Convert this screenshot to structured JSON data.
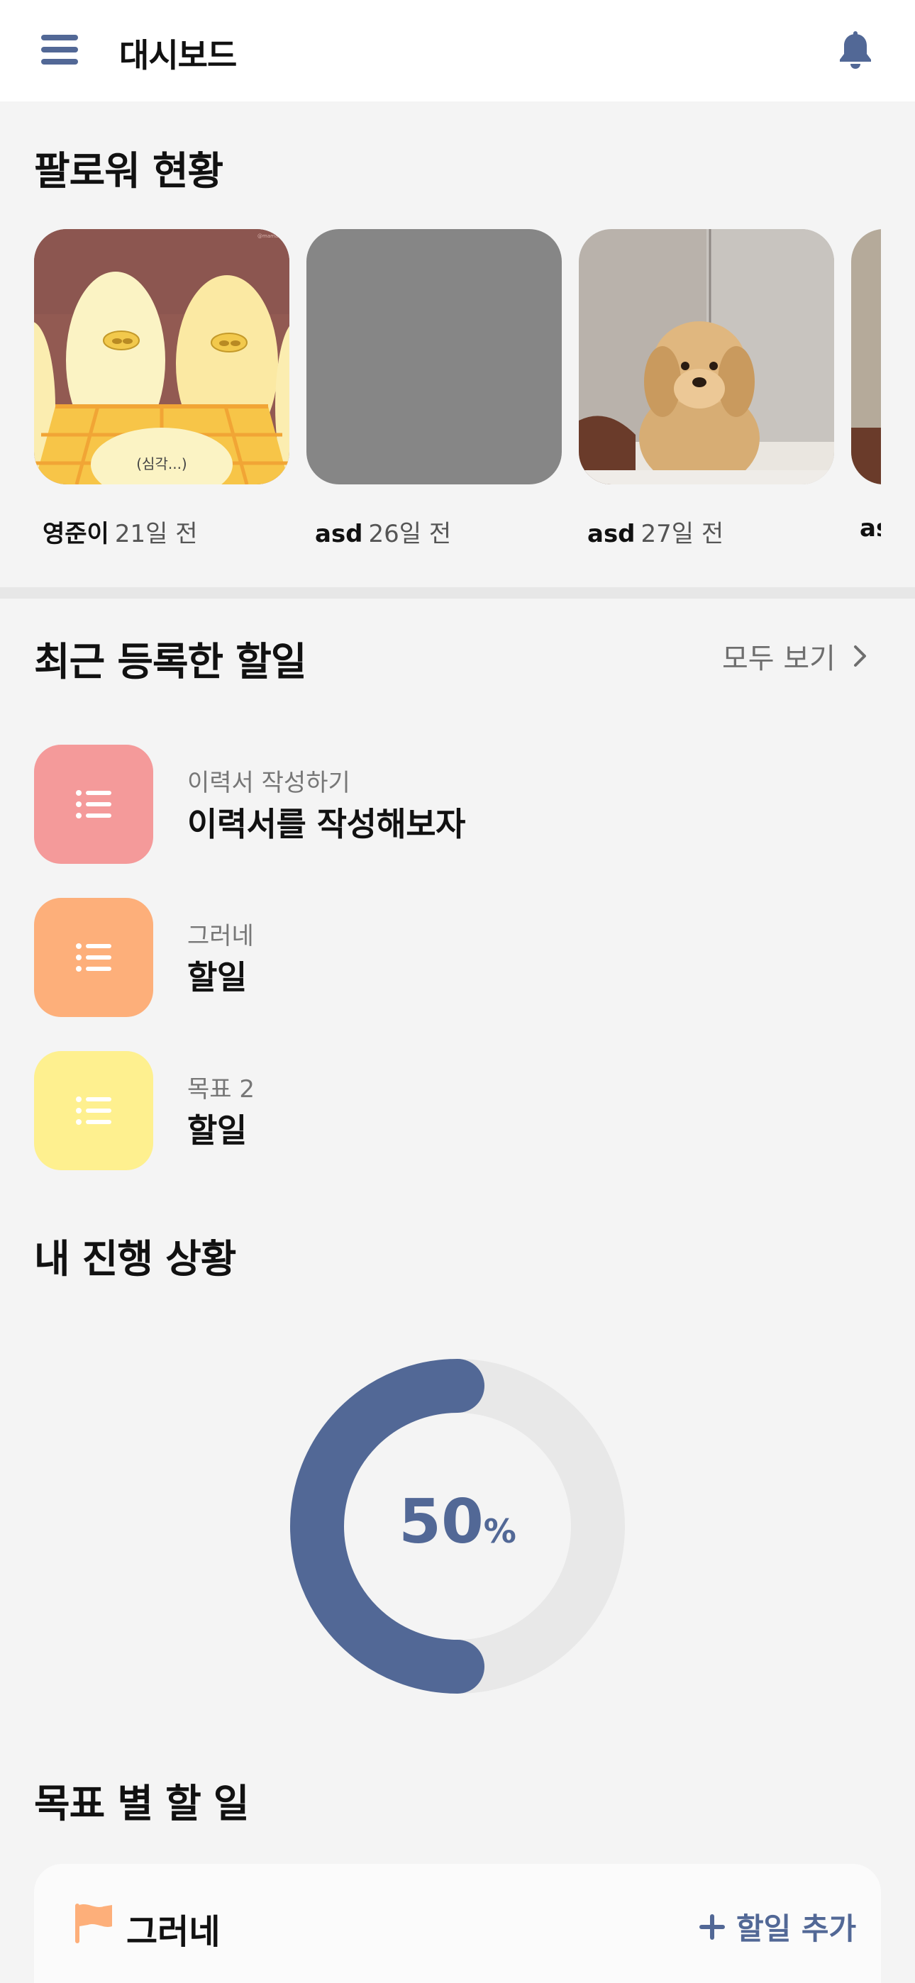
{
  "header": {
    "title": "대시보드",
    "menu_icon": "menu-icon",
    "bell_icon": "bell-icon"
  },
  "followers": {
    "title": "팔로워 현황",
    "items": [
      {
        "name": "영준이",
        "ago": "21일 전",
        "thumb_text": "(심각...)",
        "watermark": "@mamafarm"
      },
      {
        "name": "asd",
        "ago": "26일 전"
      },
      {
        "name": "asd",
        "ago": "27일 전"
      },
      {
        "name": "as",
        "ago": ""
      }
    ]
  },
  "recent_todos": {
    "title": "최근 등록한 할일",
    "see_all": "모두 보기",
    "items": [
      {
        "category": "이력서 작성하기",
        "title": "이력서를 작성해보자",
        "color": "#f49a9a"
      },
      {
        "category": "그러네",
        "title": "할일",
        "color": "#fdaf7a"
      },
      {
        "category": "목표 2",
        "title": "할일",
        "color": "#fef08f"
      }
    ]
  },
  "progress": {
    "title": "내 진행 상황",
    "value": "50",
    "unit": "%",
    "fraction": 0.5,
    "color": "#526896",
    "track_color": "#e8e8e8"
  },
  "goals": {
    "title": "목표 별 할 일",
    "items": [
      {
        "name": "그러네",
        "add_label": "할일 추가",
        "flag_color": "#fdaf7a"
      }
    ]
  },
  "colors": {
    "accent": "#526896",
    "background": "#f4f4f4"
  }
}
